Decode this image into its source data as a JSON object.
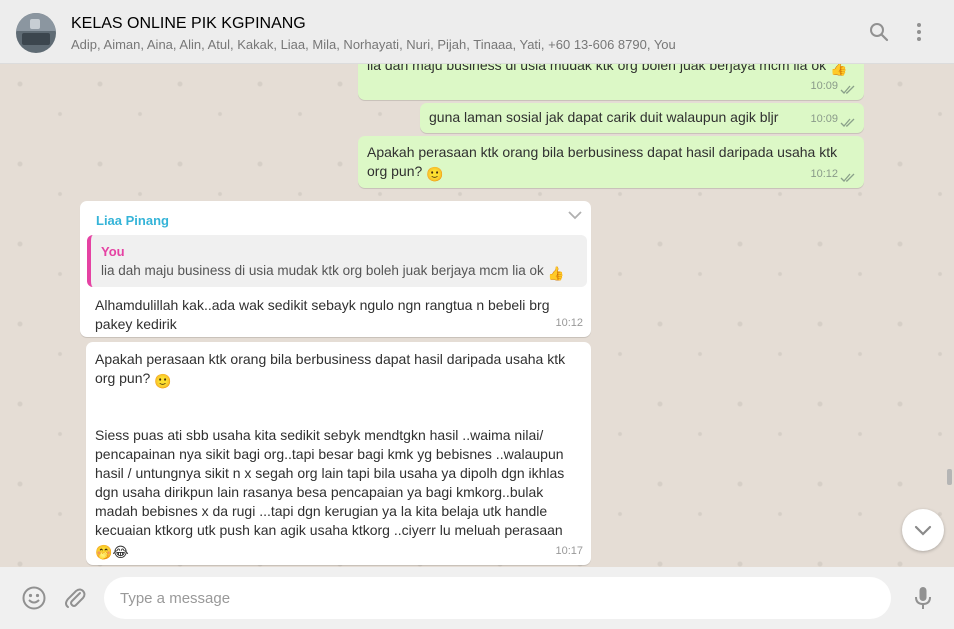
{
  "header": {
    "title": "KELAS ONLINE PIK KGPINANG",
    "members": "Adip, Aiman, Aina, Alin, Atul, Kakak, Liaa, Mila, Norhayati, Nuri, Pijah, Tinaaa, Yati, +60 13-606 8790, You",
    "icons": [
      "search-icon",
      "menu-icon"
    ]
  },
  "messages": {
    "m1": {
      "text": "lia dah maju business di usia mudak ktk org boleh juak berjaya mcm lia ok",
      "emoji": "👍",
      "time": "10:09"
    },
    "m2": {
      "text": "guna laman sosial jak dapat carik duit walaupun agik bljr",
      "time": "10:09"
    },
    "m3": {
      "line1": "Apakah perasaan ktk orang bila berbusiness dapat hasil daripada usaha ktk",
      "line2": "org pun?",
      "emoji": "🙂",
      "time": "10:12"
    },
    "m4": {
      "sender": "Liaa Pinang",
      "quote_author": "You",
      "quote_text": "lia dah maju business di usia mudak ktk org boleh juak berjaya mcm lia ok",
      "quote_emoji": "👍",
      "line1": "Alhamdulillah kak..ada wak sedikit sebayk ngulo ngn rangtua n bebeli brg",
      "line2": "pakey kedirik",
      "time": "10:12"
    },
    "m5": {
      "line1": "Apakah perasaan ktk orang bila berbusiness dapat hasil daripada usaha ktk",
      "line2": "org pun?",
      "emoji": "🙂",
      "lines": [
        "Siess puas ati sbb usaha kita sedikit sebyk mendtgkn hasil ..waima nilai/",
        "pencapainan nya sikit bagi org..tapi besar bagi kmk yg bebisnes ..walaupun",
        "hasil / untungnya sikit n x segah org lain tapi bila usaha ya dipolh dgn ikhlas",
        "dgn usaha dirikpun lain rasanya  besa pencapaian ya bagi kmkorg..bulak",
        "madah bebisnes x da rugi ...tapi dgn kerugian ya la kita belaja utk handle",
        "kecuaian ktkorg utk push kan agik usaha ktkorg ..ciyerr lu meluah perasaan"
      ],
      "end_emoji": "🤭😂",
      "time": "10:17"
    }
  },
  "footer": {
    "placeholder": "Type a message",
    "icons": [
      "emoji-icon",
      "attach-icon",
      "mic-icon"
    ]
  },
  "colors": {
    "outgoing_bubble": "#dcf8c6",
    "incoming_bubble": "#ffffff",
    "sender_name": "#35b4d8",
    "quote_accent": "#e542a3",
    "chat_background": "#e5ddd5"
  }
}
